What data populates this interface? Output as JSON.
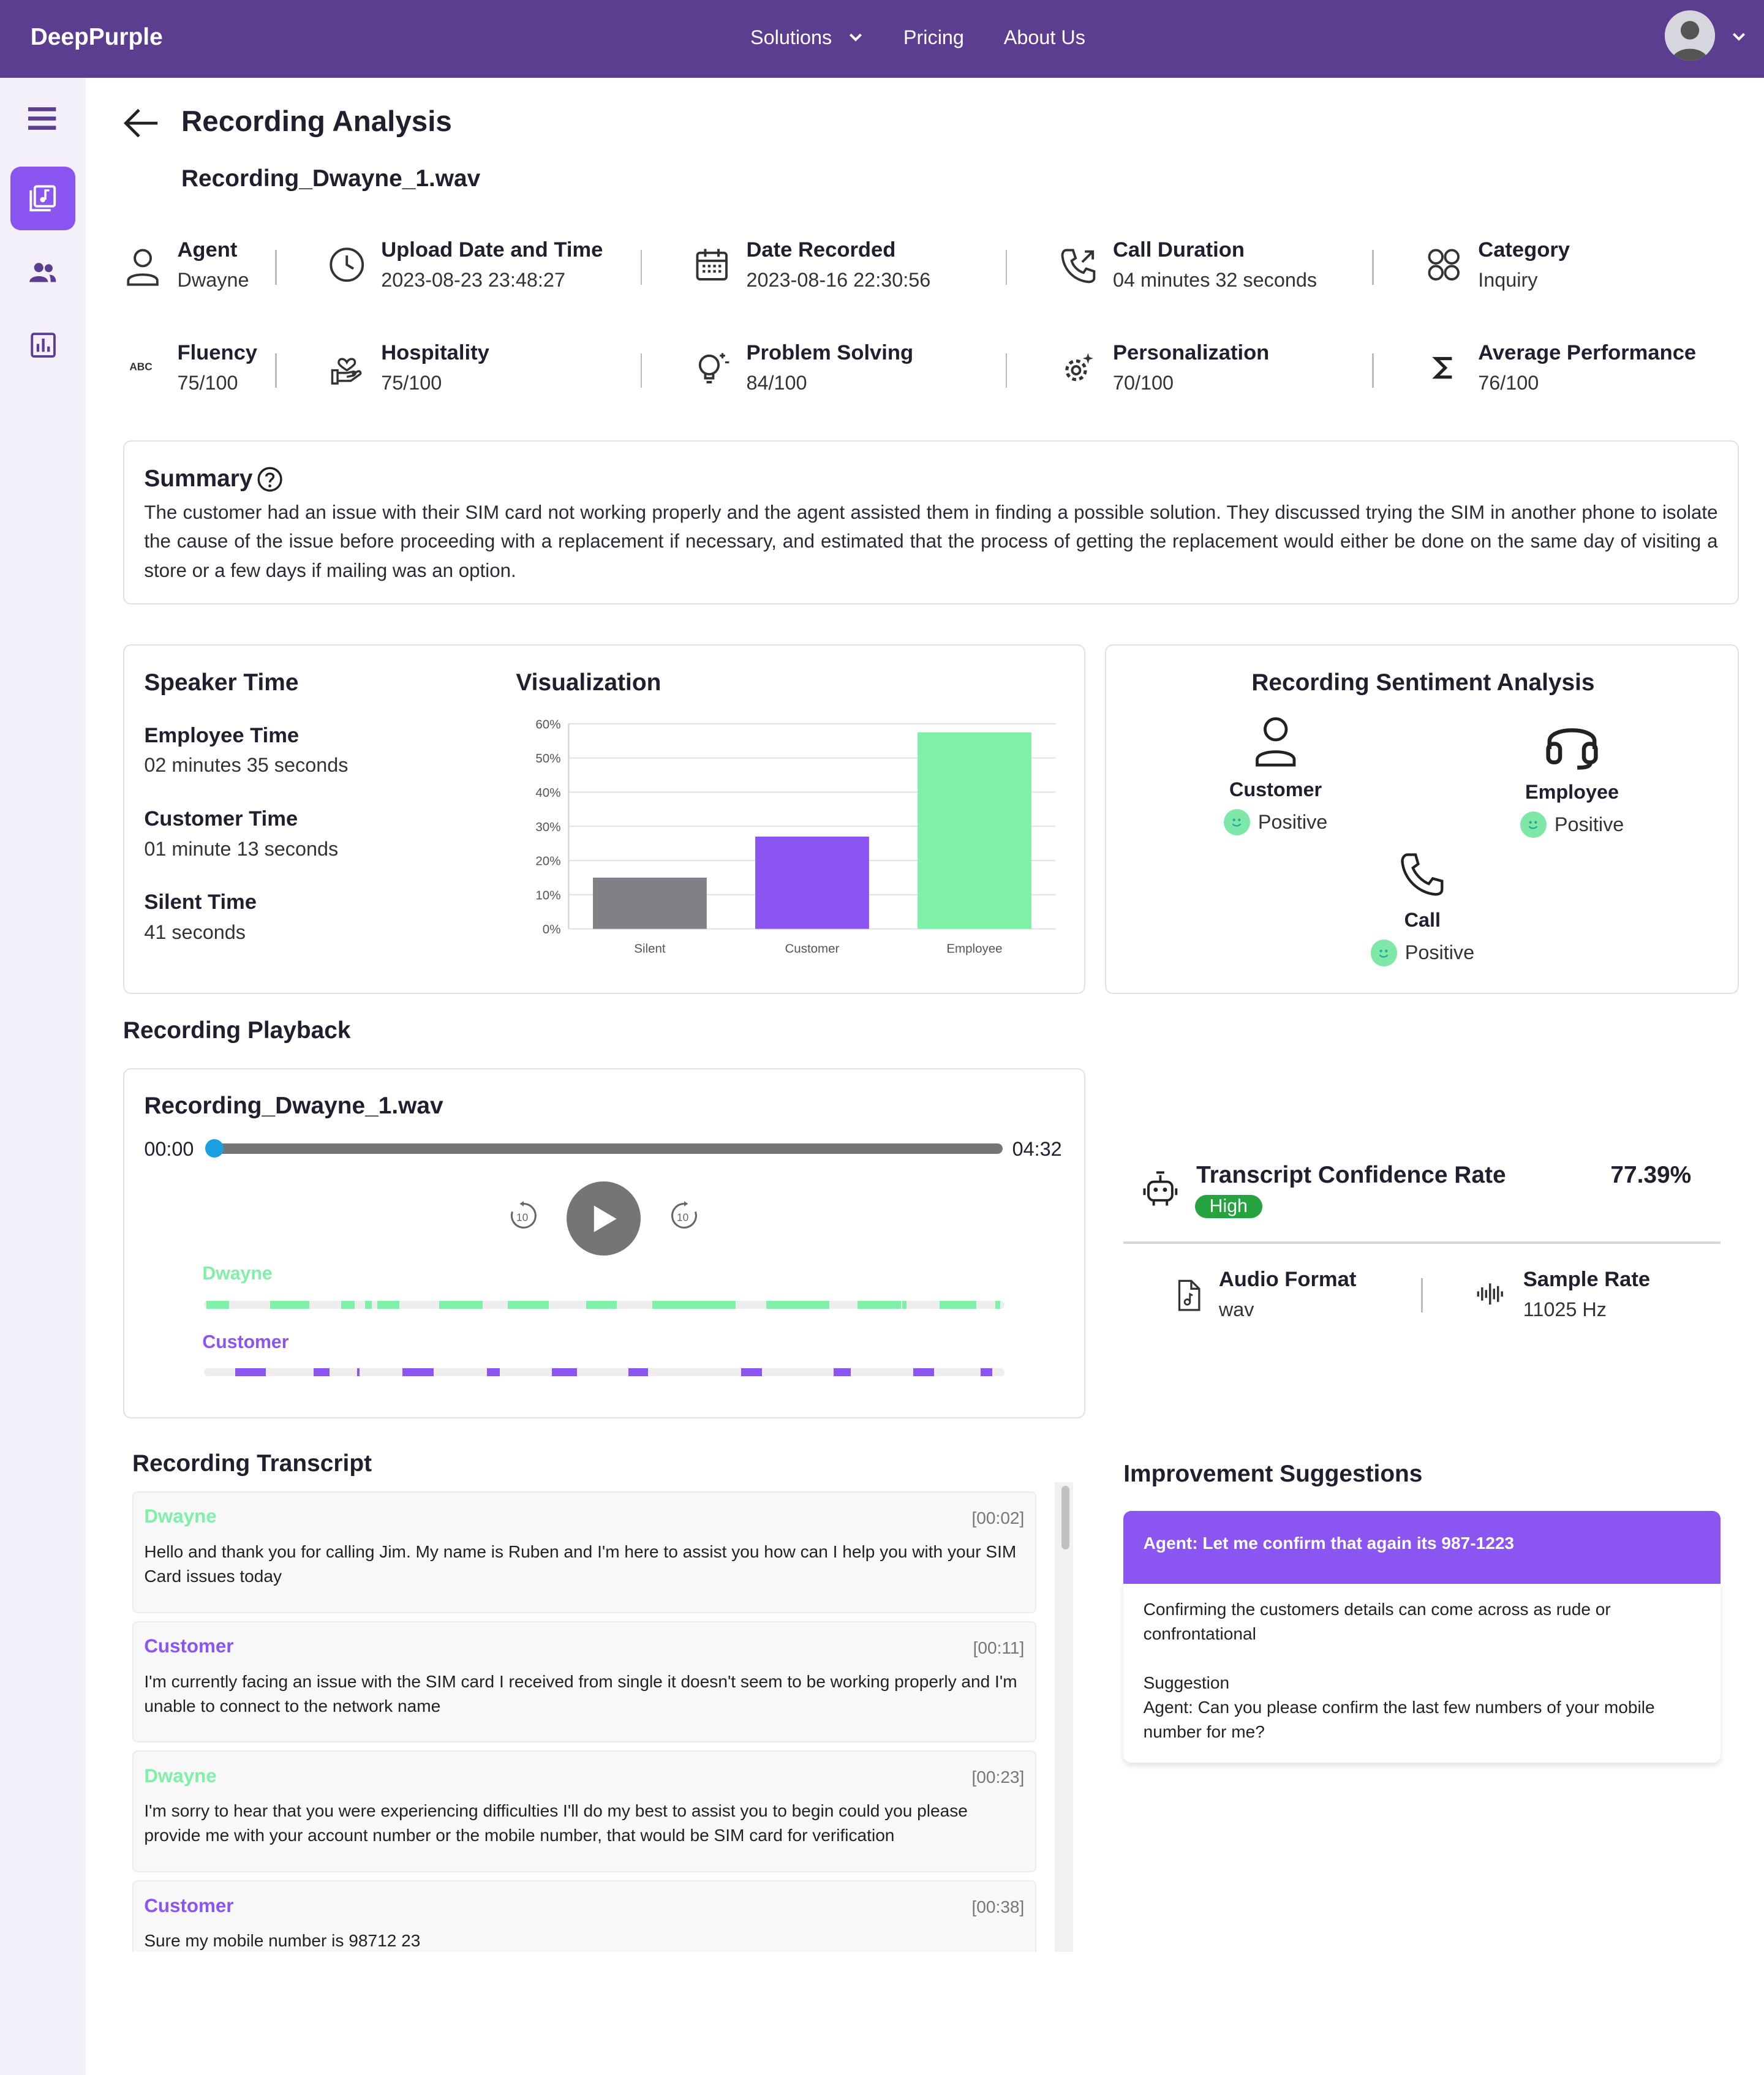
{
  "header": {
    "brand": "DeepPurple",
    "nav": [
      "Solutions",
      "Pricing",
      "About Us"
    ]
  },
  "page": {
    "title": "Recording Analysis",
    "filename": "Recording_Dwayne_1.wav"
  },
  "info_row1": [
    {
      "label": "Agent",
      "value": "Dwayne",
      "icon": "person-icon"
    },
    {
      "label": "Upload Date and Time",
      "value": "2023-08-23 23:48:27",
      "icon": "clock-icon"
    },
    {
      "label": "Date Recorded",
      "value": "2023-08-16 22:30:56",
      "icon": "calendar-icon"
    },
    {
      "label": "Call Duration",
      "value": "04 minutes 32 seconds",
      "icon": "phone-outgoing-icon"
    },
    {
      "label": "Category",
      "value": "Inquiry",
      "icon": "category-icon"
    }
  ],
  "info_row2": [
    {
      "label": "Fluency",
      "value": "75/100",
      "icon": "abc-icon"
    },
    {
      "label": "Hospitality",
      "value": "75/100",
      "icon": "hand-heart-icon"
    },
    {
      "label": "Problem Solving",
      "value": "84/100",
      "icon": "lightbulb-icon"
    },
    {
      "label": "Personalization",
      "value": "70/100",
      "icon": "gear-sparkle-icon"
    },
    {
      "label": "Average Performance",
      "value": "76/100",
      "icon": "sigma-icon"
    }
  ],
  "summary": {
    "title": "Summary",
    "text": "The customer had an issue with their SIM card not working properly and the agent assisted them in finding a possible solution. They discussed trying the SIM in another phone to isolate the cause of the issue before proceeding with a replacement if necessary, and estimated that the process of getting the replacement would either be done on the same day of visiting a store or a few days if mailing was an option."
  },
  "speaker_time": {
    "title": "Speaker Time",
    "items": [
      {
        "label": "Employee Time",
        "value": "02 minutes 35 seconds"
      },
      {
        "label": "Customer Time",
        "value": "01 minute 13 seconds"
      },
      {
        "label": "Silent Time",
        "value": "41 seconds"
      }
    ]
  },
  "visualization_title": "Visualization",
  "chart_data": {
    "type": "bar",
    "categories": [
      "Silent",
      "Customer",
      "Employee"
    ],
    "values": [
      15,
      27,
      57.5
    ],
    "colors": [
      "#808086",
      "#8b55f2",
      "#80f0a8"
    ],
    "ylim": [
      0,
      60
    ],
    "yticks": [
      "0%",
      "10%",
      "20%",
      "30%",
      "40%",
      "50%",
      "60%"
    ],
    "grid": true
  },
  "sentiment": {
    "title": "Recording Sentiment Analysis",
    "customer": {
      "name": "Customer",
      "value": "Positive"
    },
    "employee": {
      "name": "Employee",
      "value": "Positive"
    },
    "call": {
      "name": "Call",
      "value": "Positive"
    }
  },
  "playback": {
    "section_title": "Recording Playback",
    "filename": "Recording_Dwayne_1.wav",
    "current": "00:00",
    "total": "04:32",
    "progress": 0,
    "speakers": [
      {
        "name": "Dwayne",
        "color": "#80f0a8"
      },
      {
        "name": "Customer",
        "color": "#8b55f2"
      }
    ]
  },
  "confidence": {
    "title": "Transcript Confidence Rate",
    "value": "77.39%",
    "badge": "High",
    "audio_format_label": "Audio Format",
    "audio_format": "wav",
    "sample_rate_label": "Sample Rate",
    "sample_rate": "11025 Hz"
  },
  "transcript": {
    "title": "Recording Transcript",
    "items": [
      {
        "speaker": "Dwayne",
        "time": "[00:02]",
        "text": "Hello and thank you for calling Jim. My name is Ruben and I'm here to assist you how can I help you with your SIM Card issues today"
      },
      {
        "speaker": "Customer",
        "time": "[00:11]",
        "text": "I'm currently facing an issue with the SIM card I received from single it doesn't seem to be working properly and I'm unable to connect to the network name"
      },
      {
        "speaker": "Dwayne",
        "time": "[00:23]",
        "text": "I'm sorry to hear that you were experiencing difficulties I'll do my best to assist you to begin could you please provide me with your account number or the mobile number, that would be SIM card for verification"
      },
      {
        "speaker": "Customer",
        "time": "[00:38]",
        "text": "Sure my mobile number is 98712 23"
      }
    ]
  },
  "improvement": {
    "title": "Improvement Suggestions",
    "head": "Agent: Let me confirm that again its 987-1223",
    "issue": "Confirming the customers details can come across as rude or confrontational",
    "suggestion_label": "Suggestion",
    "suggestion": "Agent: Can you please confirm the last few numbers of your mobile number for me?"
  }
}
